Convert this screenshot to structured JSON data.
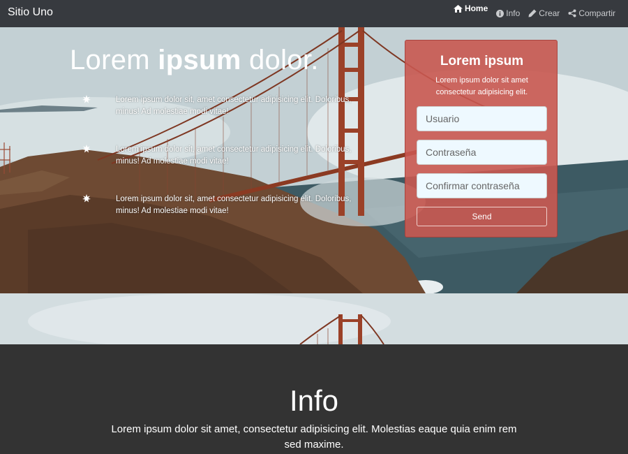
{
  "navbar": {
    "brand": "Sitio Uno",
    "links": [
      {
        "label": "Home",
        "icon": "home-icon"
      },
      {
        "label": "Info",
        "icon": "info-icon"
      },
      {
        "label": "Crear",
        "icon": "pencil-icon"
      },
      {
        "label": "Compartir",
        "icon": "share-icon"
      }
    ]
  },
  "hero": {
    "title_light": "Lorem ",
    "title_bold": "ipsum",
    "title_end": " dolor.",
    "features": [
      "Lorem ipsum dolor sit, amet consectetur adipisicing elit. Doloribus, minus! Ad molestiae modi vitae!",
      "Lorem ipsum dolor sit, amet consectetur adipisicing elit. Doloribus, minus! Ad molestiae modi vitae!",
      "Lorem ipsum dolor sit, amet consectetur adipisicing elit. Doloribus, minus! Ad molestiae modi vitae!"
    ]
  },
  "form": {
    "title": "Lorem ipsum",
    "subtitle": "Lorem ipsum dolor sit amet consectetur adipisicing elit.",
    "user_placeholder": "Usuario",
    "password_placeholder": "Contraseña",
    "confirm_placeholder": "Confirmar contraseña",
    "send_label": "Send"
  },
  "info": {
    "title": "Info",
    "text": "Lorem ipsum dolor sit amet, consectetur adipisicing elit. Molestias eaque quia enim rem sed maxime."
  },
  "colors": {
    "navbar": "#373a3f",
    "card": "#c95850",
    "info_bg": "#333333"
  }
}
